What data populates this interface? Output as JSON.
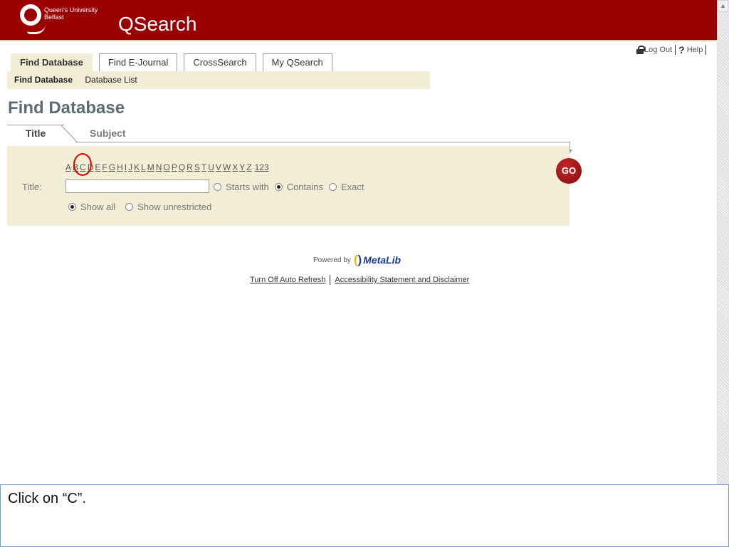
{
  "header": {
    "logo_text_line1": "Queen's University",
    "logo_text_line2": "Belfast",
    "app_title": "QSearch",
    "bg_color": "#9b0000"
  },
  "top_links": {
    "logout": "Log Out",
    "help": "Help",
    "help_icon": "?"
  },
  "tabs": [
    {
      "label": "Find Database",
      "active": true
    },
    {
      "label": "Find E-Journal",
      "active": false
    },
    {
      "label": "CrossSearch",
      "active": false
    },
    {
      "label": "My QSearch",
      "active": false
    }
  ],
  "subnav": {
    "current": "Find Database",
    "link": "Database List"
  },
  "page_title": "Find Database",
  "search_tabs": {
    "title": "Title",
    "subject": "Subject"
  },
  "alphabet": [
    "A",
    "B",
    "C",
    "D",
    "E",
    "F",
    "G",
    "H",
    "I",
    "J",
    "K",
    "L",
    "M",
    "N",
    "O",
    "P",
    "Q",
    "R",
    "S",
    "T",
    "U",
    "V",
    "W",
    "X",
    "Y",
    "Z"
  ],
  "alphabet_numeric": "123",
  "form": {
    "title_label": "Title:",
    "title_value": "",
    "match_options": [
      {
        "label": "Starts with",
        "checked": false
      },
      {
        "label": "Contains",
        "checked": true
      },
      {
        "label": "Exact",
        "checked": false
      }
    ],
    "scope_options": [
      {
        "label": "Show all",
        "checked": true
      },
      {
        "label": "Show unrestricted",
        "checked": false
      }
    ],
    "go_label": "GO"
  },
  "footer": {
    "powered_by": "Powered by",
    "metalib_name": "MetaLib",
    "links": [
      "Turn Off Auto Refresh",
      "Accessibility Statement and Disclaimer"
    ]
  },
  "instruction": "Click on “C”.",
  "colors": {
    "accent_panel": "#f2eed6",
    "highlight_circle": "#e00000"
  }
}
